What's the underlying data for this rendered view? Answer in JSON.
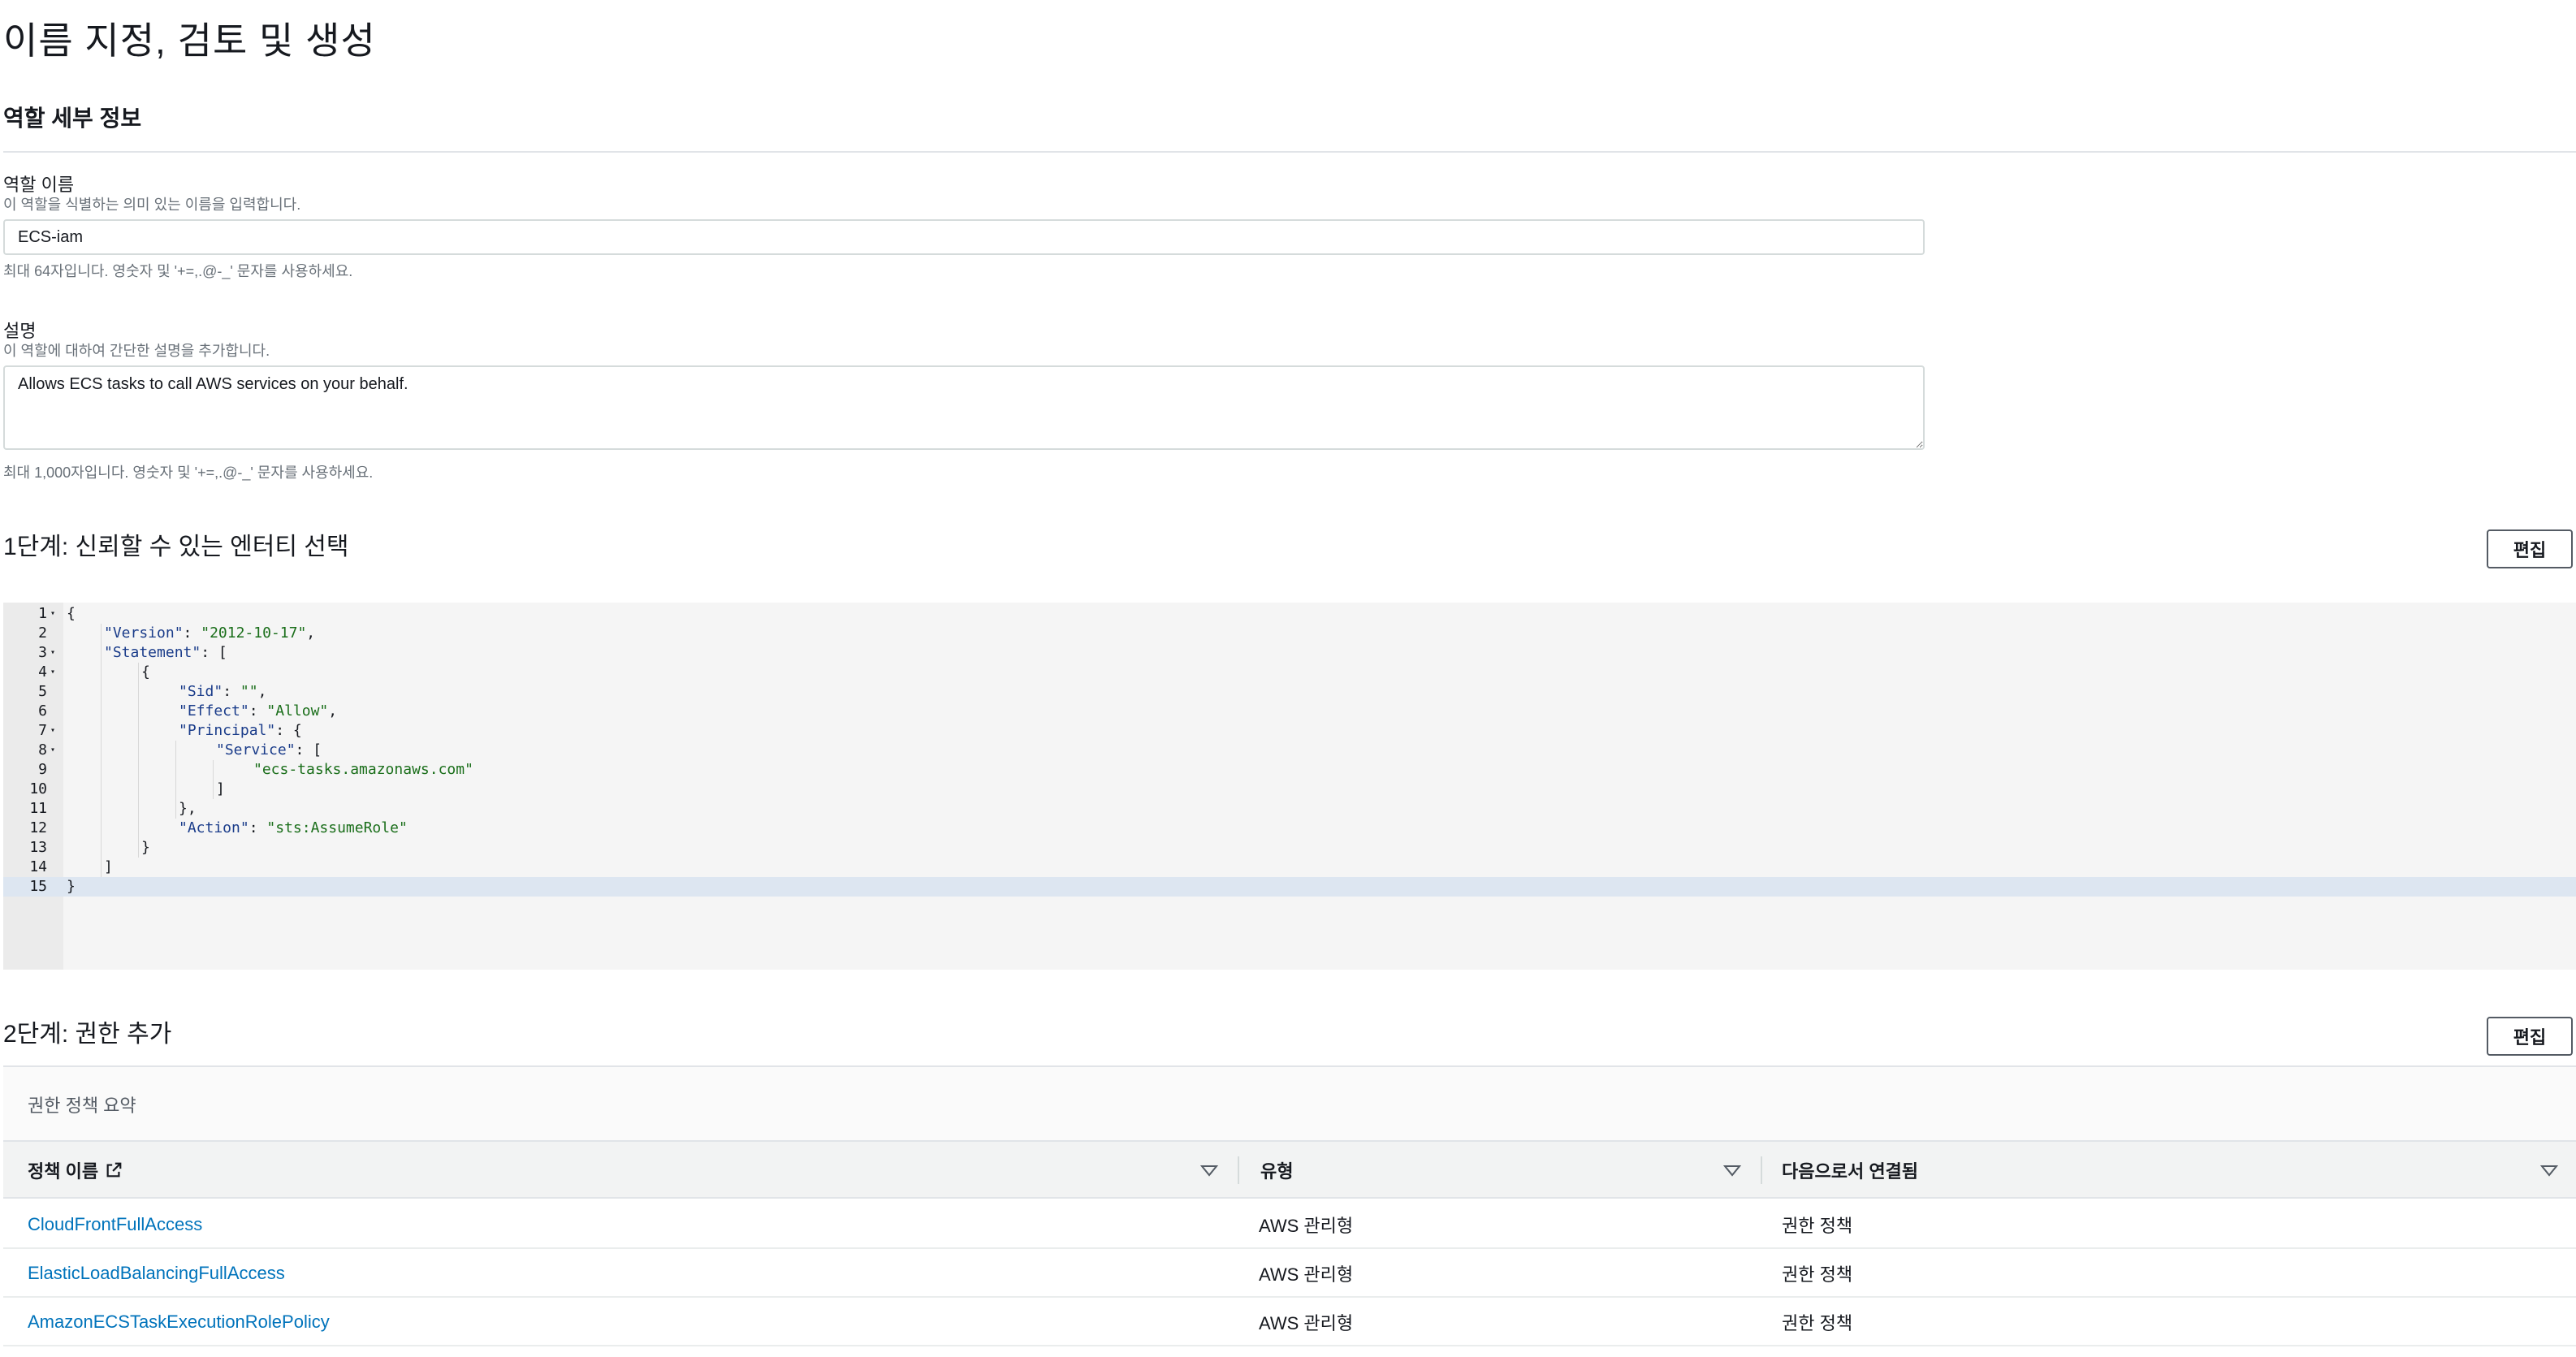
{
  "page_title": "이름 지정, 검토 및 생성",
  "role_details": {
    "heading": "역할 세부 정보",
    "name": {
      "label": "역할 이름",
      "description": "이 역할을 식별하는 의미 있는 이름을 입력합니다.",
      "value": "ECS-iam",
      "hint": "최대 64자입니다. 영숫자 및 '+=,.@-_' 문자를 사용하세요."
    },
    "description": {
      "label": "설명",
      "description": "이 역할에 대하여 간단한 설명을 추가합니다.",
      "value": "Allows ECS tasks to call AWS services on your behalf.",
      "hint": "최대 1,000자입니다. 영숫자 및 '+=,.@-_' 문자를 사용하세요."
    }
  },
  "step1": {
    "title": "1단계: 신뢰할 수 있는 엔터티 선택",
    "edit_label": "편집",
    "code_lines": [
      {
        "n": "1",
        "fold": true,
        "indent": 0,
        "parts": [
          {
            "t": "{",
            "c": ""
          }
        ]
      },
      {
        "n": "2",
        "fold": false,
        "indent": 1,
        "parts": [
          {
            "t": "\"Version\"",
            "c": "k"
          },
          {
            "t": ": ",
            "c": ""
          },
          {
            "t": "\"2012-10-17\"",
            "c": "s"
          },
          {
            "t": ",",
            "c": ""
          }
        ]
      },
      {
        "n": "3",
        "fold": true,
        "indent": 1,
        "parts": [
          {
            "t": "\"Statement\"",
            "c": "k"
          },
          {
            "t": ": [",
            "c": ""
          }
        ]
      },
      {
        "n": "4",
        "fold": true,
        "indent": 2,
        "parts": [
          {
            "t": "{",
            "c": ""
          }
        ]
      },
      {
        "n": "5",
        "fold": false,
        "indent": 3,
        "parts": [
          {
            "t": "\"Sid\"",
            "c": "k"
          },
          {
            "t": ": ",
            "c": ""
          },
          {
            "t": "\"\"",
            "c": "s"
          },
          {
            "t": ",",
            "c": ""
          }
        ]
      },
      {
        "n": "6",
        "fold": false,
        "indent": 3,
        "parts": [
          {
            "t": "\"Effect\"",
            "c": "k"
          },
          {
            "t": ": ",
            "c": ""
          },
          {
            "t": "\"Allow\"",
            "c": "s"
          },
          {
            "t": ",",
            "c": ""
          }
        ]
      },
      {
        "n": "7",
        "fold": true,
        "indent": 3,
        "parts": [
          {
            "t": "\"Principal\"",
            "c": "k"
          },
          {
            "t": ": {",
            "c": ""
          }
        ]
      },
      {
        "n": "8",
        "fold": true,
        "indent": 4,
        "parts": [
          {
            "t": "\"Service\"",
            "c": "k"
          },
          {
            "t": ": [",
            "c": ""
          }
        ]
      },
      {
        "n": "9",
        "fold": false,
        "indent": 5,
        "parts": [
          {
            "t": "\"ecs-tasks.amazonaws.com\"",
            "c": "s"
          }
        ]
      },
      {
        "n": "10",
        "fold": false,
        "indent": 4,
        "parts": [
          {
            "t": "]",
            "c": ""
          }
        ]
      },
      {
        "n": "11",
        "fold": false,
        "indent": 3,
        "parts": [
          {
            "t": "},",
            "c": ""
          }
        ]
      },
      {
        "n": "12",
        "fold": false,
        "indent": 3,
        "parts": [
          {
            "t": "\"Action\"",
            "c": "k"
          },
          {
            "t": ": ",
            "c": ""
          },
          {
            "t": "\"sts:AssumeRole\"",
            "c": "s"
          }
        ]
      },
      {
        "n": "13",
        "fold": false,
        "indent": 2,
        "parts": [
          {
            "t": "}",
            "c": ""
          }
        ]
      },
      {
        "n": "14",
        "fold": false,
        "indent": 1,
        "parts": [
          {
            "t": "]",
            "c": ""
          }
        ]
      },
      {
        "n": "15",
        "fold": false,
        "indent": 0,
        "active": true,
        "parts": [
          {
            "t": "}",
            "c": ""
          }
        ]
      }
    ]
  },
  "step2": {
    "title": "2단계: 권한 추가",
    "edit_label": "편집",
    "summary_title": "권한 정책 요약",
    "columns": [
      "정책 이름",
      "유형",
      "다음으로서 연결됨"
    ],
    "rows": [
      {
        "name": "CloudFrontFullAccess",
        "type": "AWS 관리형",
        "attached": "권한 정책"
      },
      {
        "name": "ElasticLoadBalancingFullAccess",
        "type": "AWS 관리형",
        "attached": "권한 정책"
      },
      {
        "name": "AmazonECSTaskExecutionRolePolicy",
        "type": "AWS 관리형",
        "attached": "권한 정책"
      }
    ]
  },
  "colors": {
    "link": "#0073bb",
    "json_key": "#1a3c8a",
    "json_string": "#1a6e1a",
    "active_line": "#dde6f1"
  },
  "icons": [
    "fold-arrow-icon",
    "external-link-icon",
    "sort-caret-icon",
    "resize-handle-icon"
  ]
}
